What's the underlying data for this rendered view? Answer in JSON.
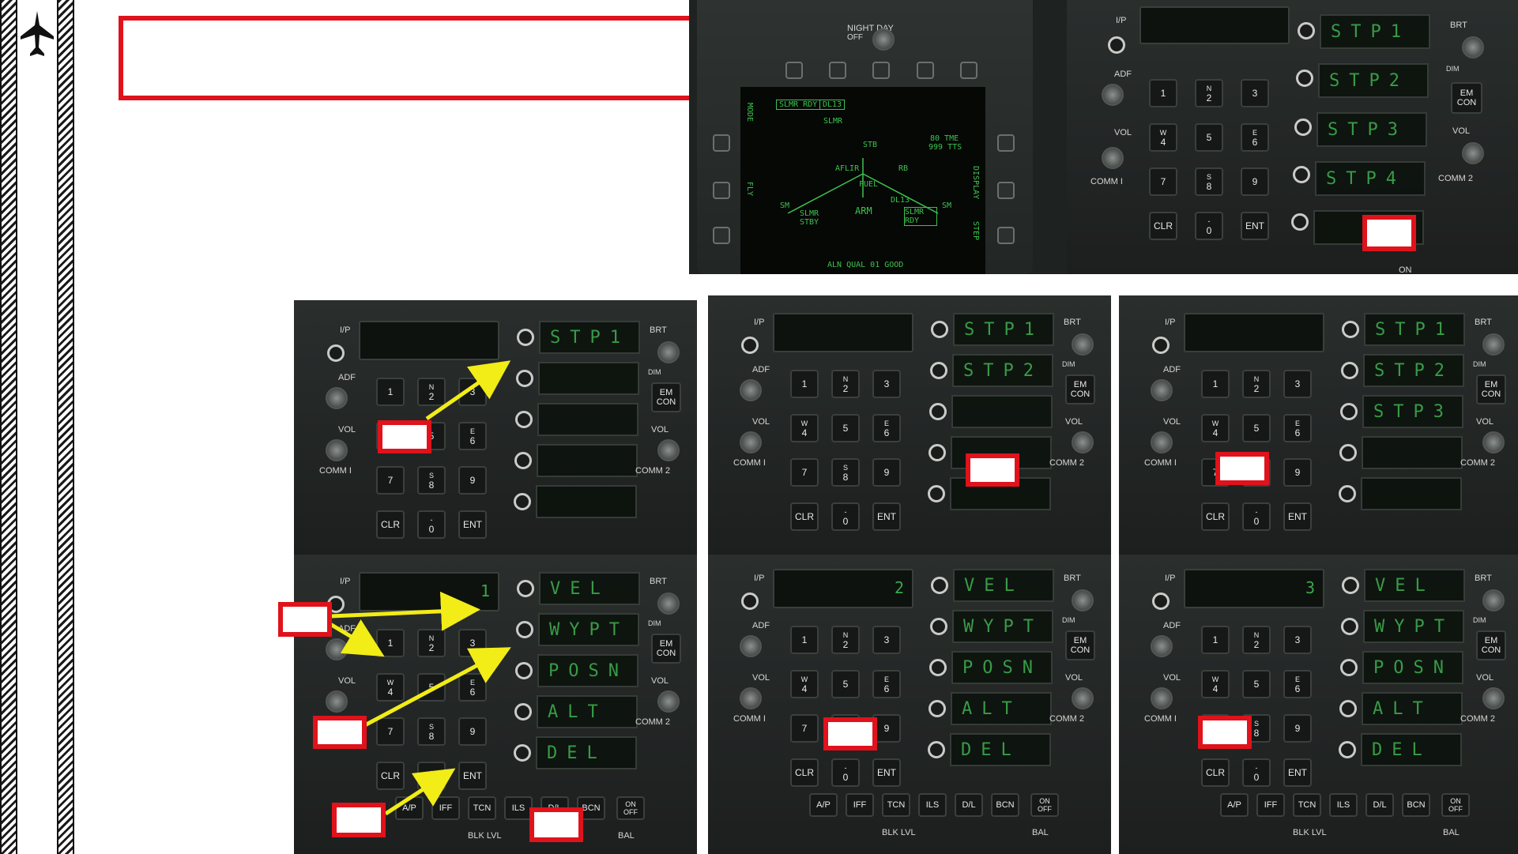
{
  "ddi": {
    "night_day": "NIGHT DAY",
    "off": "OFF",
    "slmr_rdy": "SLMR RDY",
    "dl13_top": "DL13",
    "slmr": "SLMR",
    "stb": "STB",
    "tme": "80 TME",
    "tts": "999 TTS",
    "aflir": "AFLIR",
    "rb": "RB",
    "fuel": "FUEL",
    "sm_left": "SM",
    "sm_right": "SM",
    "dl13_mid": "DL13",
    "arm": "ARM",
    "slmr_stby": "SLMR STBY",
    "slmr_rdy2": "SLMR RDY",
    "aln": "ALN QUAL 01 GOOD",
    "mode": "MODE",
    "fly": "FLY",
    "display": "DISPLAY",
    "step": "STEP"
  },
  "ufc_labels": {
    "ip": "I/P",
    "adf": "ADF",
    "vol": "VOL",
    "comm1": "COMM I",
    "comm2": "COMM 2",
    "brt": "BRT",
    "dim": "DIM",
    "em": "EM",
    "con": "CON",
    "clr": "CLR",
    "ent": "ENT",
    "on": "ON",
    "off": "OFF",
    "ap": "A/P",
    "iff": "IFF",
    "tcn": "TCN",
    "ils": "ILS",
    "dl": "D/L",
    "bcn": "BCN",
    "blk_lvl": "BLK LVL",
    "bal": "BAL",
    "one": "1"
  },
  "keypad": [
    {
      "num": "1",
      "sub": ""
    },
    {
      "num": "2",
      "sub": "N"
    },
    {
      "num": "3",
      "sub": ""
    },
    {
      "num": "4",
      "sub": "W"
    },
    {
      "num": "5",
      "sub": ""
    },
    {
      "num": "6",
      "sub": "E"
    },
    {
      "num": "7",
      "sub": ""
    },
    {
      "num": "8",
      "sub": "S"
    },
    {
      "num": "9",
      "sub": ""
    }
  ],
  "zero": {
    "num": "0",
    "sub": "-"
  },
  "steps": [
    "STP1",
    "STP2",
    "STP3",
    "STP4"
  ],
  "wpt_opts": [
    "VEL",
    "WYPT",
    "POSN",
    "ALT",
    "DEL"
  ],
  "scratch": [
    "1",
    "2",
    "3"
  ],
  "colors": {
    "callout": "#e0121b",
    "arrow": "#f2ec17",
    "green": "#3aa84a"
  }
}
